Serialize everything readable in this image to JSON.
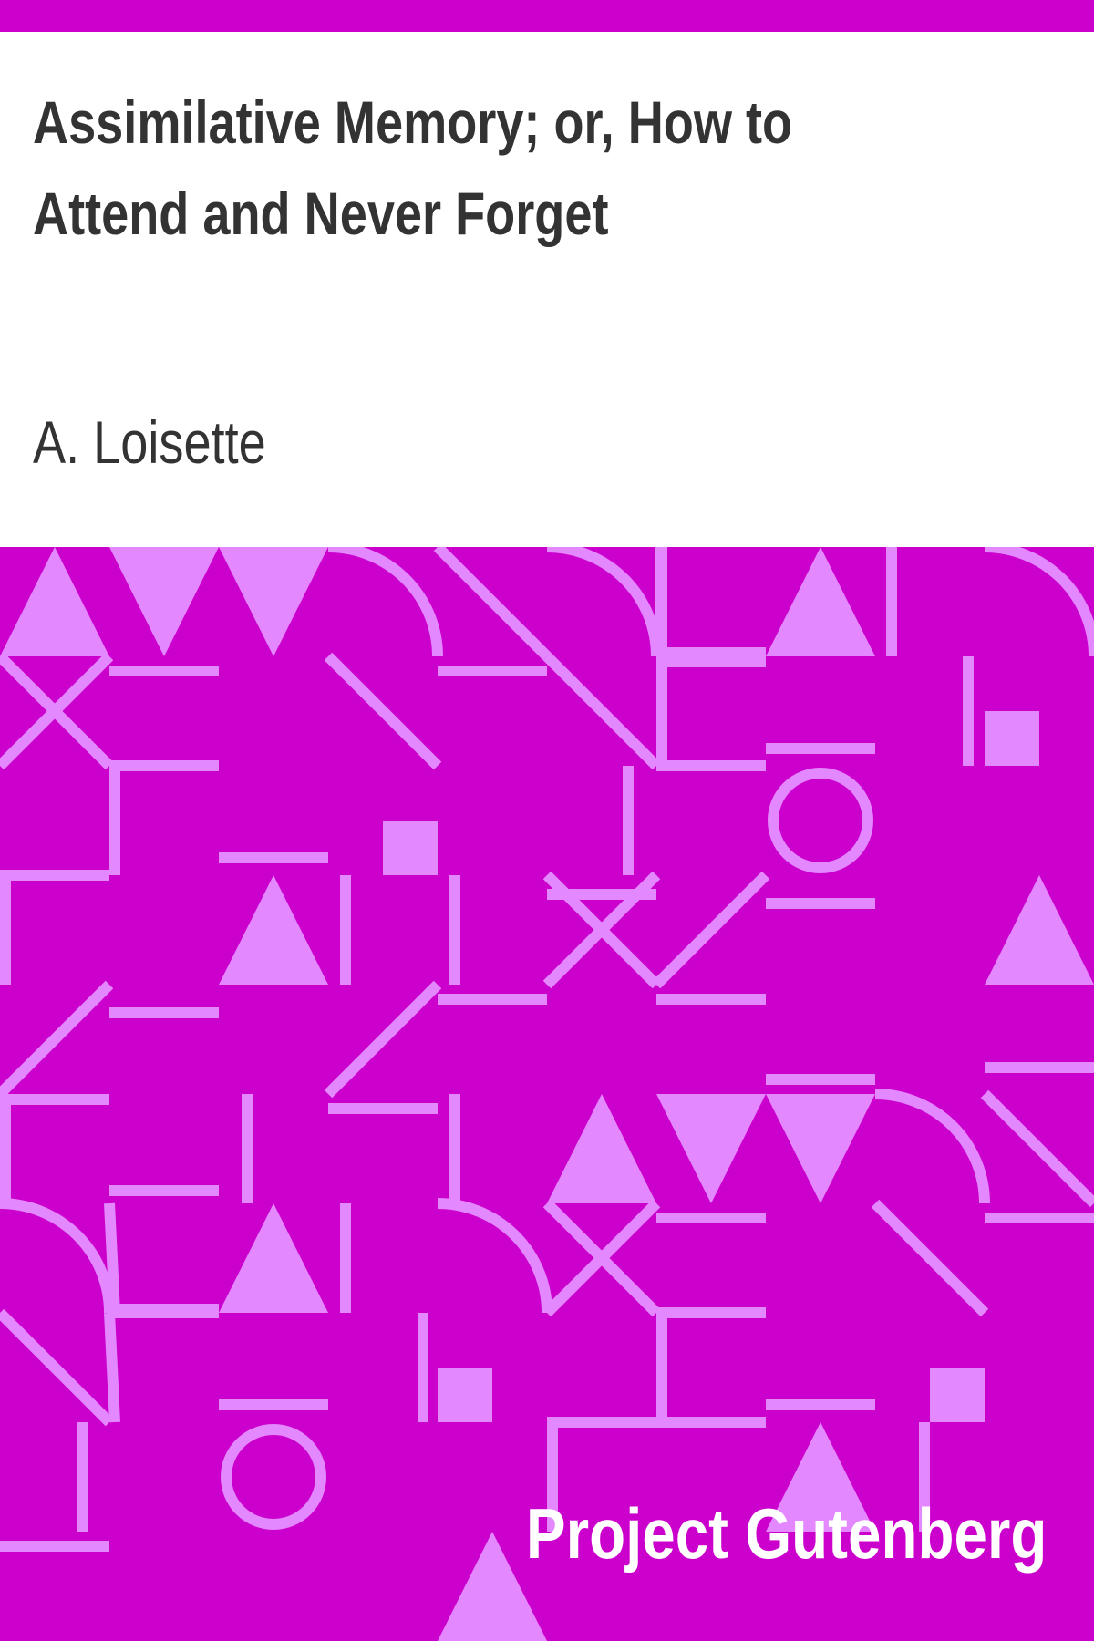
{
  "book": {
    "title": "Assimilative Memory; or, How to Attend and Never Forget",
    "author": "A. Loisette",
    "publisher": "Project Gutenberg"
  },
  "colors": {
    "background_accent": "#cc00cc",
    "pattern_shape": "#e388ff",
    "text_dark": "#333333",
    "text_light": "#ffffff",
    "header_bg": "#ffffff"
  },
  "pattern": {
    "shape_names": [
      "triangle",
      "inverted-triangle",
      "square",
      "ring",
      "quarter-arc",
      "cross",
      "diagonal-line",
      "horizontal-bar",
      "vertical-bar",
      "corner-bracket"
    ]
  }
}
